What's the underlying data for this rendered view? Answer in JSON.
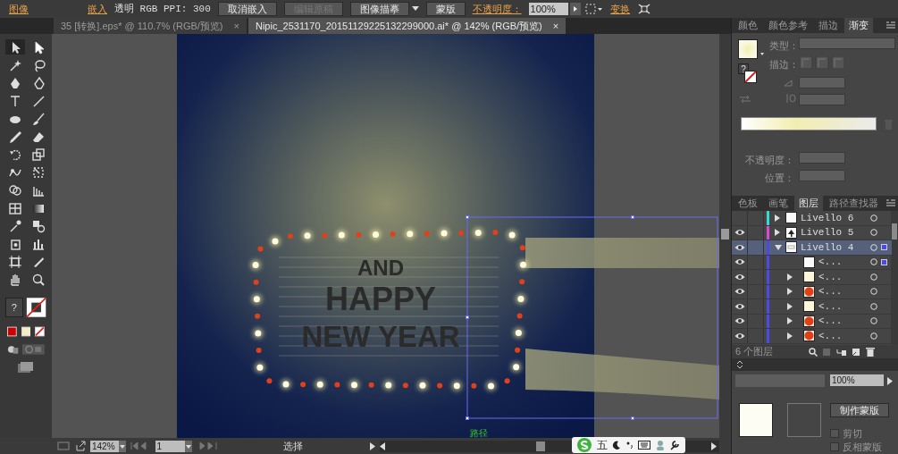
{
  "control_bar": {
    "items": [
      {
        "kind": "link",
        "label": "图像"
      },
      {
        "kind": "link",
        "label": "嵌入"
      },
      {
        "kind": "text",
        "label": "透明 RGB  PPI: 300"
      },
      {
        "kind": "button",
        "label": "取消嵌入",
        "disabled": false
      },
      {
        "kind": "button",
        "label": "编辑原稿",
        "disabled": true
      },
      {
        "kind": "dropdown",
        "label": "图像描摹",
        "disabled": false
      },
      {
        "kind": "button",
        "label": "蒙版",
        "disabled": false
      },
      {
        "kind": "link",
        "label": "不透明度："
      },
      {
        "kind": "field",
        "label": "100%"
      },
      {
        "kind": "link",
        "label": "变换"
      }
    ]
  },
  "doc_tabs": [
    {
      "label": "35 [转换].eps* @ 110.7% (RGB/预览)",
      "close": "×",
      "selected": false
    },
    {
      "label": "Nipic_2531170_20151129225132299000.ai* @ 142% (RGB/预览)",
      "close": "×",
      "selected": true
    }
  ],
  "toolbar": {
    "fill_swatch": "?"
  },
  "artwork": {
    "lines": [
      "AND",
      "HAPPY",
      "NEW YEAR"
    ],
    "path_label": "路径"
  },
  "gradient_panel": {
    "tabs": [
      {
        "label": "颜色",
        "selected": false
      },
      {
        "label": "颜色参考",
        "selected": false
      },
      {
        "label": "描边",
        "selected": false
      },
      {
        "label": "渐变",
        "selected": true
      }
    ],
    "fill_swatch": "?",
    "type_label": "类型：",
    "stroke_label": "描边：",
    "opacity_label": "不透明度：",
    "position_label": "位置："
  },
  "layers_panel": {
    "tabs": [
      {
        "label": "色板",
        "selected": false
      },
      {
        "label": "画笔",
        "selected": false
      },
      {
        "label": "图层",
        "selected": true
      },
      {
        "label": "路径查找器",
        "selected": false
      }
    ],
    "layers": [
      {
        "name": "Livello 6",
        "visible": false,
        "expanded": false,
        "selected": false,
        "color": "#3ad6d6",
        "kind": "blank",
        "marked": false
      },
      {
        "name": "Livello 5",
        "visible": true,
        "expanded": false,
        "selected": false,
        "color": "#d64ad6",
        "kind": "tree",
        "marked": false
      },
      {
        "name": "Livello 4",
        "visible": true,
        "expanded": true,
        "selected": true,
        "color": "#4a4ae6",
        "kind": "frame",
        "marked": true,
        "children": [
          {
            "name": "<...",
            "visible": true,
            "expandable": false,
            "kind": "blank",
            "marked": true
          },
          {
            "name": "<...",
            "visible": true,
            "expandable": true,
            "kind": "cream",
            "marked": false
          },
          {
            "name": "<...",
            "visible": true,
            "expandable": true,
            "kind": "red",
            "marked": false
          },
          {
            "name": "<...",
            "visible": true,
            "expandable": true,
            "kind": "cream",
            "marked": false
          },
          {
            "name": "<...",
            "visible": true,
            "expandable": true,
            "kind": "red",
            "marked": false
          },
          {
            "name": "<...",
            "visible": true,
            "expandable": true,
            "kind": "red",
            "marked": false
          }
        ]
      }
    ],
    "count": "6 个图层"
  },
  "transparency_panel": {
    "opacity": "100%",
    "make_mask": "制作蒙版",
    "options": [
      {
        "label": "剪切",
        "checked": false
      },
      {
        "label": "反相蒙版",
        "checked": false
      }
    ]
  },
  "status_bar": {
    "zoom": "142%",
    "page": "1",
    "tool": "选择"
  },
  "ime_bar": {
    "mode": "五"
  }
}
